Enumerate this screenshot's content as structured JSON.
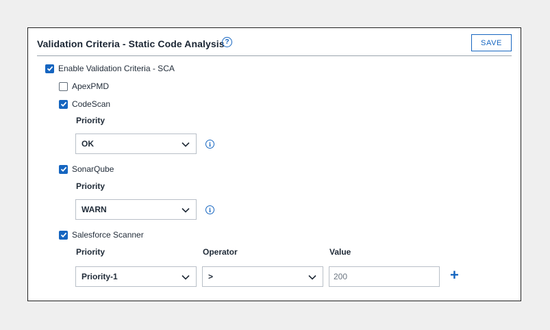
{
  "header": {
    "title": "Validation Criteria - Static Code Analysis",
    "help_icon": "question-circle-icon",
    "save_label": "SAVE"
  },
  "enable": {
    "label": "Enable Validation Criteria - SCA",
    "checked": true
  },
  "tools": {
    "apexpmd": {
      "label": "ApexPMD",
      "checked": false
    },
    "codescan": {
      "label": "CodeScan",
      "checked": true,
      "priority_label": "Priority",
      "priority_value": "OK",
      "info_icon": "info-circle-icon"
    },
    "sonarqube": {
      "label": "SonarQube",
      "checked": true,
      "priority_label": "Priority",
      "priority_value": "WARN",
      "info_icon": "info-circle-icon"
    },
    "sfscanner": {
      "label": "Salesforce Scanner",
      "checked": true,
      "priority_label": "Priority",
      "priority_value": "Priority-1",
      "operator_label": "Operator",
      "operator_value": ">",
      "value_label": "Value",
      "value": "200",
      "add_icon": "plus-icon"
    }
  },
  "colors": {
    "accent": "#1565c0",
    "border": "#b8bfc7",
    "background": "#efefef"
  }
}
